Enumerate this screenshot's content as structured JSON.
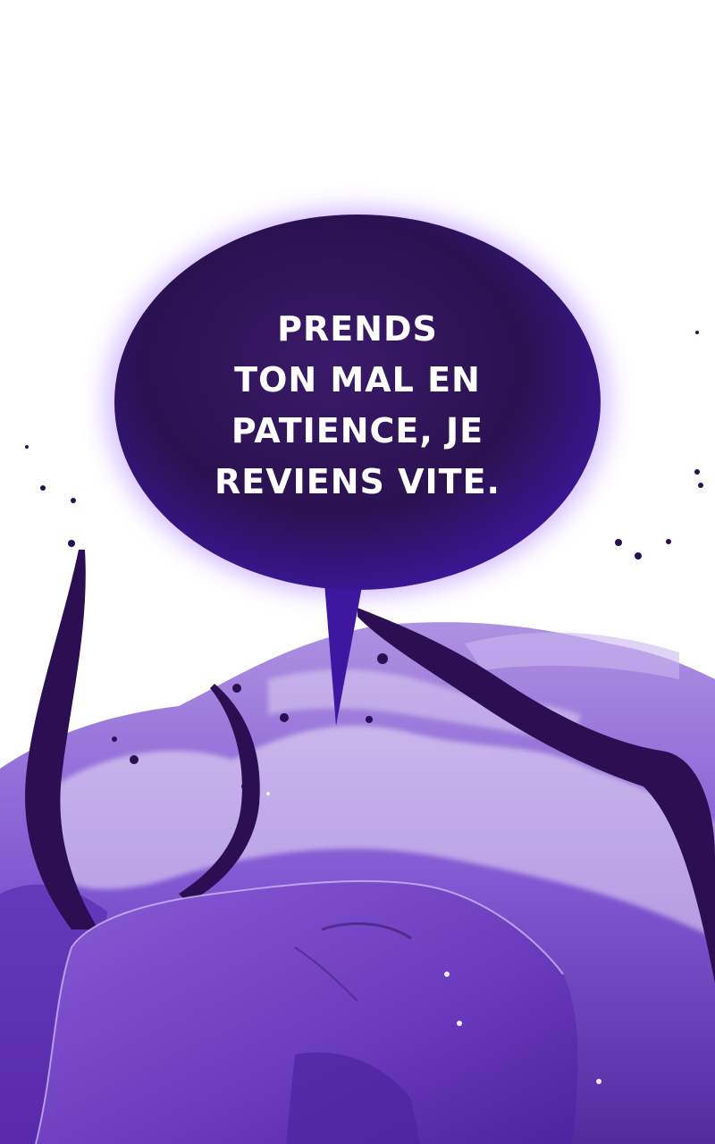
{
  "speech_bubble": {
    "lines": [
      "PRENDS",
      "TON MAL EN",
      "PATIENCE, JE",
      "REVIENS VITE."
    ]
  },
  "colors": {
    "background": "#ffffff",
    "bubble_fill": "#2a1250",
    "bubble_glow": "#8a4dff",
    "smoke_purple": "#6a2fc4",
    "dark_purple": "#2b0f52",
    "hood_purple": "#7a45c8",
    "text": "#ffffff"
  }
}
